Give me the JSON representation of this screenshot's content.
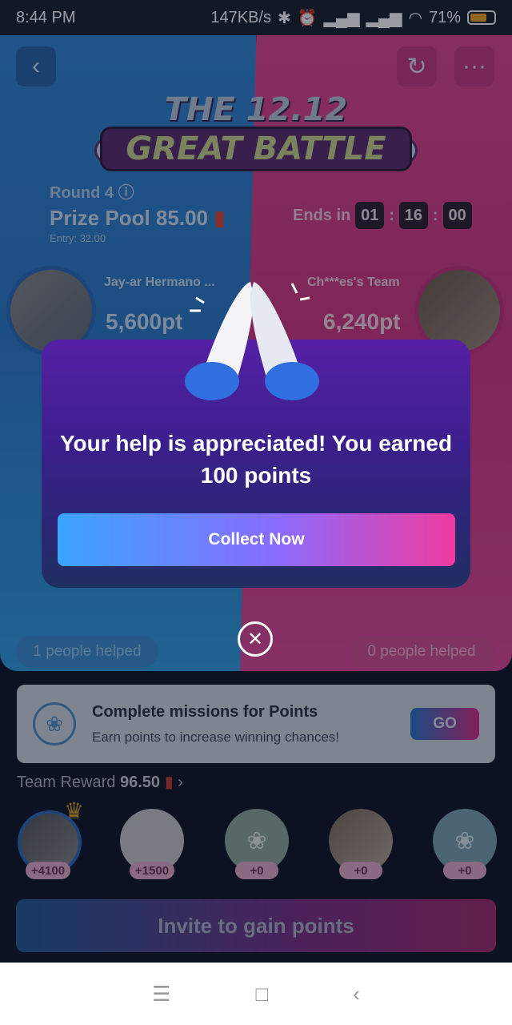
{
  "status": {
    "time": "8:44 PM",
    "speed": "147KB/s",
    "battery": "71%"
  },
  "event": {
    "title_line1": "THE 12.12",
    "title_line2": "GREAT BATTLE"
  },
  "round": {
    "label": "Round 4",
    "prize_pool": "Prize Pool 85.00",
    "entry": "Entry: 32.00"
  },
  "timer": {
    "label": "Ends in",
    "h": "01",
    "m": "16",
    "s": "00",
    "sep": ":"
  },
  "team_left": {
    "name": "Jay-ar Hermano ...",
    "points": "5,600pt",
    "helped": "1 people helped",
    "badge": "M"
  },
  "team_right": {
    "name": "Ch***es's Team",
    "points": "6,240pt",
    "helped": "0 people helped",
    "badge": "M"
  },
  "modal": {
    "message": "Your help is appreciated! You earned 100 points",
    "button": "Collect Now"
  },
  "missions": {
    "title": "Complete missions for Points",
    "subtitle": "Earn points to increase winning chances!",
    "button": "GO"
  },
  "reward": {
    "label": "Team Reward",
    "amount": "96.50"
  },
  "members": [
    {
      "points": "+4100",
      "icon": "crown-icon"
    },
    {
      "points": "+1500"
    },
    {
      "points": "+0"
    },
    {
      "points": "+0"
    },
    {
      "points": "+0"
    }
  ],
  "invite": {
    "label": "Invite to gain points"
  },
  "nav": {
    "menu": "☰",
    "home": "□",
    "back": "‹"
  },
  "colors": {
    "left_team": "#2f86d4",
    "right_team": "#e0458f",
    "modal": "#4a1e9a"
  }
}
